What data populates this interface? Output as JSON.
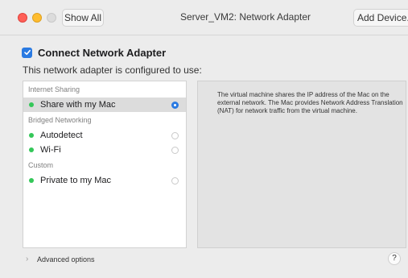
{
  "window": {
    "title": "Server_VM2: Network Adapter",
    "show_all_label": "Show All",
    "add_device_label": "Add Device..."
  },
  "header": {
    "connect_label": "Connect Network Adapter",
    "connect_checked": true,
    "configured_text": "This network adapter is configured to use:"
  },
  "list": {
    "sections": [
      {
        "title": "Internet Sharing",
        "items": [
          {
            "label": "Share with my Mac",
            "selected": true,
            "status_color": "#34c759"
          }
        ]
      },
      {
        "title": "Bridged Networking",
        "items": [
          {
            "label": "Autodetect",
            "selected": false,
            "status_color": "#34c759"
          },
          {
            "label": "Wi-Fi",
            "selected": false,
            "status_color": "#34c759"
          }
        ]
      },
      {
        "title": "Custom",
        "items": [
          {
            "label": "Private to my Mac",
            "selected": false,
            "status_color": "#34c759"
          }
        ]
      }
    ]
  },
  "description": {
    "text": "The virtual machine shares the IP address of the Mac on the external network. The Mac provides Network Address Translation (NAT) for network traffic from the virtual machine."
  },
  "footer": {
    "advanced_label": "Advanced options",
    "help_label": "?"
  },
  "colors": {
    "accent": "#2a7ae2",
    "status_green": "#34c759",
    "selected_row": "#dcdcdc"
  }
}
